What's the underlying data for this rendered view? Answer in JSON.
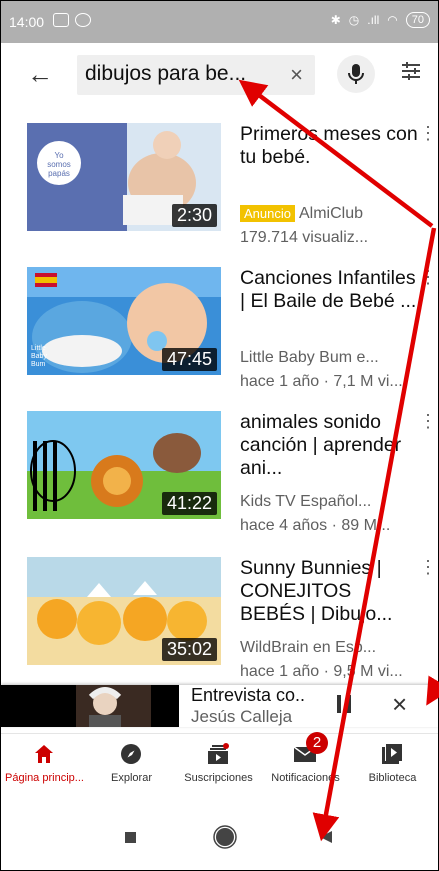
{
  "status_bar": {
    "time": "14:00",
    "battery": "70",
    "icons_left": [
      "image-icon",
      "whatsapp-icon"
    ],
    "icons_right": [
      "bluetooth-icon",
      "alarm-icon",
      "signal-icon",
      "wifi-icon",
      "battery-icon"
    ]
  },
  "search": {
    "query": "dibujos para be...",
    "clear": "×",
    "back_icon": "arrow-left-icon",
    "mic_icon": "microphone-icon",
    "filter_icon": "filter-sliders-icon"
  },
  "videos": [
    {
      "title": "Primeros meses con tu bebé.",
      "thumb_text": "Yo somos papás",
      "duration": "2:30",
      "ad_badge": "Anuncio",
      "channel": "AlmiClub",
      "meta": "179.714 visualiz..."
    },
    {
      "title": "Canciones Infantiles | El Baile de Bebé ...",
      "thumb_text": "Little Baby Bum",
      "duration": "47:45",
      "channel": "Little Baby Bum e...",
      "meta": "hace 1 año · 7,1 M vi..."
    },
    {
      "title": "animales sonido canción | aprender ani...",
      "duration": "41:22",
      "channel": "Kids TV Español...",
      "meta": "hace 4 años · 89 M..."
    },
    {
      "title": "Sunny Bunnies | CONEJITOS BEBÉS | Dibujo...",
      "duration": "35:02",
      "channel": "WildBrain en Esp...",
      "meta": "hace 1 año · 9,5 M vi..."
    }
  ],
  "miniplayer": {
    "title": "Entrevista co..",
    "channel": "Jesús Calleja",
    "close": "×"
  },
  "bottom_nav": {
    "tabs": [
      {
        "label": "Página princip...",
        "icon": "home-icon",
        "active": true
      },
      {
        "label": "Explorar",
        "icon": "compass-icon"
      },
      {
        "label": "Suscripciones",
        "icon": "subscriptions-icon"
      },
      {
        "label": "Notificaciones",
        "icon": "mail-icon",
        "badge": "2"
      },
      {
        "label": "Biblioteca",
        "icon": "library-icon"
      }
    ]
  },
  "system_nav": [
    "recents-square-icon",
    "home-circle-icon",
    "back-triangle-icon"
  ],
  "colors": {
    "accent": "#cc0000",
    "status_bar": "#b0b0b0",
    "ad_badge": "#f2c200",
    "annotation_arrows": "#e00000"
  }
}
